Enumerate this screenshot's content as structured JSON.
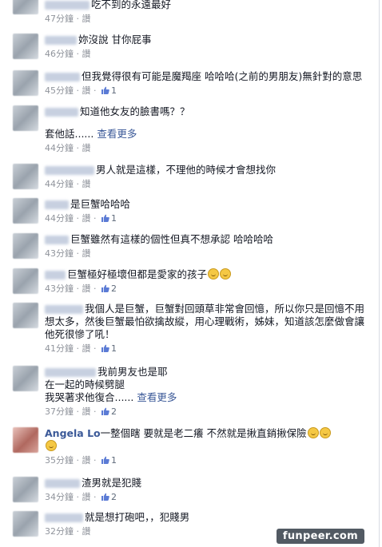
{
  "comments": [
    {
      "text": "吃不到的永遠最好",
      "time": "47分鐘",
      "like": "讚",
      "likes": null
    },
    {
      "text": "妳沒說 甘你屁事",
      "time": "46分鐘",
      "like": "讚",
      "likes": null
    },
    {
      "text": "但我覺得很有可能是魔羯座 哈哈哈(之前的男朋友)無針對的意思",
      "time": "45分鐘",
      "like": "讚",
      "likes": "1"
    },
    {
      "text": "知道他女友的臉書嗎？？",
      "text2": "套他話",
      "more": "查看更多",
      "time": "44分鐘",
      "like": "讚",
      "likes": null
    },
    {
      "text": "男人就是這樣，不理他的時候才會想找你",
      "time": "44分鐘",
      "like": "讚",
      "likes": null
    },
    {
      "text": "是巨蟹哈哈哈",
      "time": "44分鐘",
      "like": "讚",
      "likes": "1"
    },
    {
      "text": "巨蟹雖然有這樣的個性但真不想承認 哈哈哈哈",
      "time": "43分鐘",
      "like": "讚",
      "likes": null
    },
    {
      "text": "巨蟹極好極壞但都是愛家的孩子",
      "time": "43分鐘",
      "like": "讚",
      "likes": "2"
    },
    {
      "text1": "我個人是巨蟹，巨蟹對回頭草非常會回憶，所以你只是回憶不用",
      "text2": "想太多，然後巨蟹最怕欲擒故縱，用心理戰術，姊妹，知道該怎麼做會讓",
      "text3": "他死很慘了吼！",
      "time": "41分鐘",
      "like": "讚",
      "likes": "1"
    },
    {
      "text": "我前男友也是耶",
      "text2": "在一起的時候劈腿",
      "text3": "我哭著求他復合",
      "more": "查看更多",
      "time": "37分鐘",
      "like": "讚",
      "likes": "2"
    },
    {
      "name": "Angela Lo",
      "text": "一整個瞎 要就是老二癢 不然就是揪直銷揪保險",
      "time": "35分鐘",
      "like": "讚",
      "likes": "1"
    },
    {
      "text": "渣男就是犯賤",
      "time": "34分鐘",
      "like": "讚",
      "likes": "2"
    },
    {
      "text": "就是想打砲吧，，犯賤男",
      "time": "32分鐘",
      "like": "讚",
      "likes": null
    }
  ],
  "watermark": "funpeer.com",
  "colors": {
    "link": "#3b5998",
    "meta": "#90949c",
    "text": "#141823"
  }
}
